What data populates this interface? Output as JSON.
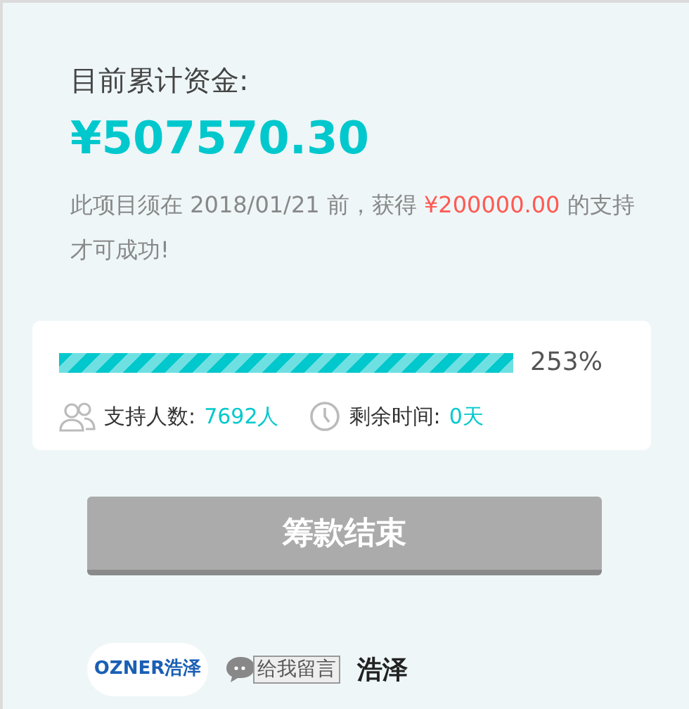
{
  "funding": {
    "label": "目前累计资金:",
    "amount": "¥507570.30",
    "note": "此项目须在 2018/01/21 前，获得 **¥200000.00** 的支持才可成功!"
  },
  "progress": {
    "level": 1,
    "reading": "253%"
  },
  "stats": [
    {
      "kind": "people",
      "label": "支持人数:",
      "value": "7692人"
    },
    {
      "kind": "time",
      "label": "剩余时间:",
      "value": "0天"
    }
  ],
  "action": {
    "label": "筹款结束",
    "disabled": true
  },
  "footer": {
    "logo": "OZNER浩泽",
    "message_button": "给我留言",
    "name": "浩泽"
  }
}
